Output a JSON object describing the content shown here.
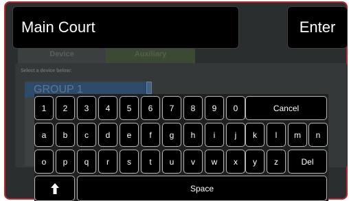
{
  "panel": {
    "tabs": [
      "Device",
      "Auxiliary"
    ],
    "select_label": "Select a device below:",
    "selected_item": "GROUP 1"
  },
  "input": {
    "value": "Main Court"
  },
  "enter_label": "Enter",
  "keyboard": {
    "row1": [
      "1",
      "2",
      "3",
      "4",
      "5",
      "6",
      "7",
      "8",
      "9",
      "0"
    ],
    "cancel": "Cancel",
    "row2": [
      "a",
      "b",
      "c",
      "d",
      "e",
      "f",
      "g",
      "h",
      "i",
      "j",
      "k",
      "l",
      "m",
      "n"
    ],
    "row3": [
      "o",
      "p",
      "q",
      "r",
      "s",
      "t",
      "u",
      "v",
      "w",
      "x",
      "y",
      "z"
    ],
    "del": "Del",
    "shift_icon": "up-arrow-icon",
    "space": "Space"
  },
  "colors": {
    "frame_border": "#b8282c",
    "key_bg": "#000000",
    "key_border": "#b8b8b8"
  }
}
